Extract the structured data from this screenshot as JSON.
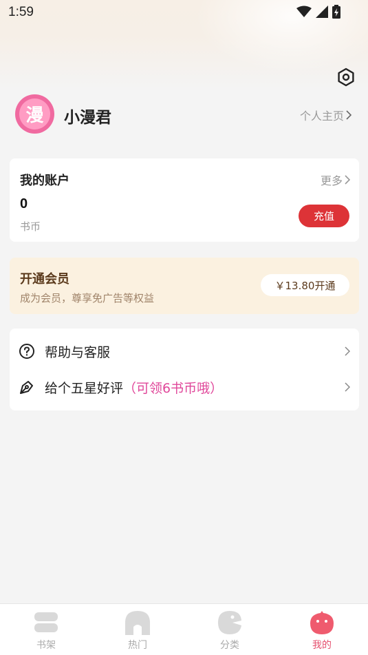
{
  "status_bar": {
    "time": "1:59"
  },
  "profile": {
    "avatar_text": "漫",
    "username": "小漫君",
    "homepage_label": "个人主页"
  },
  "account": {
    "title": "我的账户",
    "more_label": "更多",
    "coin_value": "0",
    "coin_label": "书币",
    "recharge_label": "充值"
  },
  "vip": {
    "title": "开通会员",
    "description": "成为会员，尊享免广告等权益",
    "button_label": "￥13.80开通"
  },
  "menu": {
    "items": [
      {
        "label": "帮助与客服",
        "hint": "",
        "icon": "help-circle-icon"
      },
      {
        "label": "给个五星好评",
        "hint": "（可领6书币哦）",
        "icon": "pen-icon"
      }
    ]
  },
  "tabbar": {
    "items": [
      {
        "label": "书架",
        "icon": "bookshelf-icon",
        "active": false
      },
      {
        "label": "热门",
        "icon": "popular-icon",
        "active": false
      },
      {
        "label": "分类",
        "icon": "category-icon",
        "active": false
      },
      {
        "label": "我的",
        "icon": "profile-icon",
        "active": true
      }
    ]
  },
  "colors": {
    "accent": "#dd3337",
    "active_tab": "#e5506e",
    "hint_pink": "#e0479a",
    "vip_bg": "#fbf1e0",
    "page_bg": "#f4f4f4"
  }
}
